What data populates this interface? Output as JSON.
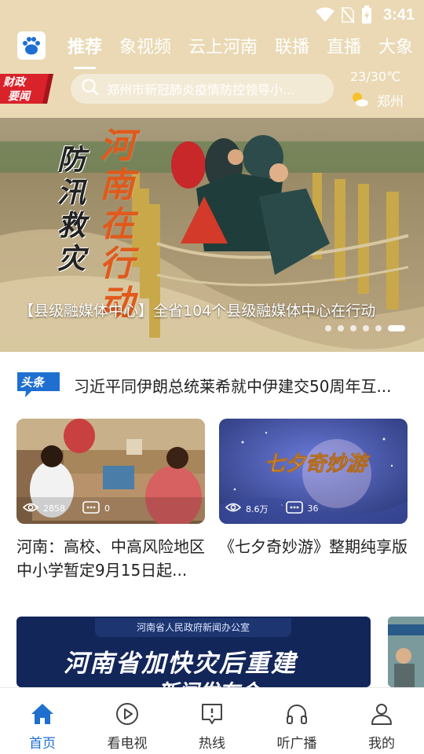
{
  "status": {
    "time": "3:41",
    "icons": [
      "wifi-icon",
      "no-sim-icon",
      "battery-charging-icon"
    ]
  },
  "nav": {
    "logo_icon": "paw-logo-icon",
    "tabs": [
      {
        "label": "推荐",
        "active": true
      },
      {
        "label": "象视频",
        "active": false
      },
      {
        "label": "云上河南",
        "active": false
      },
      {
        "label": "联播",
        "active": false
      },
      {
        "label": "直播",
        "active": false
      },
      {
        "label": "大象",
        "active": false
      }
    ]
  },
  "header": {
    "badge_line1": "财政",
    "badge_line2": "要闻",
    "search_placeholder": "郑州市新冠肺炎疫情防控领导小...",
    "weather": {
      "temp": "23/30℃",
      "city": "郑州",
      "icon": "sun-cloud-icon"
    }
  },
  "banner": {
    "vertical_text_1": "防汛救灾",
    "vertical_text_2": "河南在行动",
    "caption": "【县级融媒体中心】全省104个县级融媒体中心在行动",
    "dots": 6,
    "active_dot": 5
  },
  "headline": {
    "badge": "头条",
    "text": "习近平同伊朗总统莱希就中伊建交50周年互..."
  },
  "cards": [
    {
      "views": "2858",
      "comments": "0",
      "title": "河南：高校、中高风险地区中小学暂定9月15日起..."
    },
    {
      "thumb_text": "七夕奇妙游",
      "views": "8.6万",
      "comments": "36",
      "title": "《七夕奇妙游》整期纯享版"
    }
  ],
  "promo": {
    "sub": "河南省人民政府新闻办公室",
    "big": "河南省加快灾后重建",
    "big2": "新闻发布会"
  },
  "bottom_nav": [
    {
      "label": "首页",
      "icon": "home-icon",
      "active": true
    },
    {
      "label": "看电视",
      "icon": "play-circle-icon",
      "active": false
    },
    {
      "label": "热线",
      "icon": "hotline-icon",
      "active": false
    },
    {
      "label": "听广播",
      "icon": "headphones-icon",
      "active": false
    },
    {
      "label": "我的",
      "icon": "user-icon",
      "active": false
    }
  ],
  "colors": {
    "header_bg": "#ead9b4",
    "accent": "#1f6fd1",
    "badge_red": "#d9222a"
  }
}
